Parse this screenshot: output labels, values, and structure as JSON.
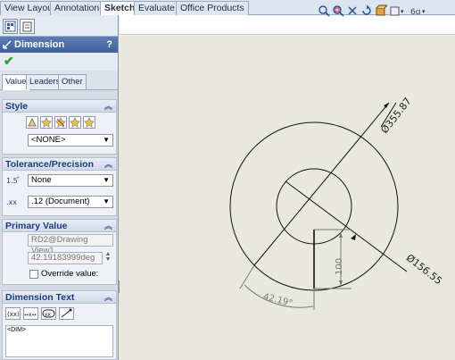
{
  "ribbon": {
    "tabs": [
      {
        "label": "View Layout",
        "active": false
      },
      {
        "label": "Annotation",
        "active": false
      },
      {
        "label": "Sketch",
        "active": true
      },
      {
        "label": "Evaluate",
        "active": false
      },
      {
        "label": "Office Products",
        "active": false
      }
    ]
  },
  "property_manager": {
    "title": "Dimension",
    "help": "?",
    "ok_icon": "checkmark-icon",
    "subtabs": [
      "Value",
      "Leaders",
      "Other"
    ],
    "style": {
      "title": "Style",
      "selected": "<NONE>"
    },
    "tolerance": {
      "title": "Tolerance/Precision",
      "tolerance_type": "None",
      "precision": ".12 (Document)"
    },
    "primary_value": {
      "title": "Primary Value",
      "name": "RD2@Drawing View1",
      "value": "42.19183999deg",
      "override_label": "Override value:"
    },
    "dimension_text": {
      "title": "Dimension Text",
      "content": "<DIM>"
    }
  },
  "drawing": {
    "dim_outer": "Ø355.87",
    "dim_inner": "Ø156.55",
    "dim_linear": "100",
    "dim_angle": "42.19°"
  },
  "colors": {
    "ribbon_bg": "#dbe5f1",
    "panel_header": "#3e5f97",
    "canvas_bg": "#e9e8df",
    "ok_green": "#2aa328"
  }
}
